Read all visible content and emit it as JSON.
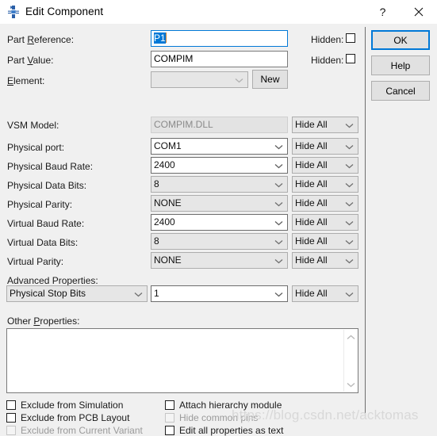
{
  "window": {
    "title": "Edit Component",
    "icon": "component-icon",
    "help_glyph": "?",
    "close_glyph": "✕"
  },
  "fields": {
    "part_reference": {
      "label_pre": "Part ",
      "label_key": "R",
      "label_post": "eference:",
      "value": "P1",
      "hidden_label": "Hidden:",
      "hidden_checked": false
    },
    "part_value": {
      "label_pre": "Part ",
      "label_key": "V",
      "label_post": "alue:",
      "value": "COMPIM",
      "hidden_label": "Hidden:",
      "hidden_checked": false
    },
    "element": {
      "label_pre": "",
      "label_key": "E",
      "label_post": "lement:",
      "value": "",
      "new_button": "New"
    },
    "vsm_model": {
      "label": "VSM Model:",
      "value": "COMPIM.DLL",
      "hide": "Hide All"
    },
    "physical_port": {
      "label": "Physical port:",
      "value": "COM1",
      "hide": "Hide All"
    },
    "physical_baud_rate": {
      "label": "Physical Baud Rate:",
      "value": "2400",
      "hide": "Hide All"
    },
    "physical_data_bits": {
      "label": "Physical Data Bits:",
      "value": "8",
      "hide": "Hide All"
    },
    "physical_parity": {
      "label": "Physical Parity:",
      "value": "NONE",
      "hide": "Hide All"
    },
    "virtual_baud_rate": {
      "label": "Virtual Baud Rate:",
      "value": "2400",
      "hide": "Hide All"
    },
    "virtual_data_bits": {
      "label": "Virtual Data Bits:",
      "value": "8",
      "hide": "Hide All"
    },
    "virtual_parity": {
      "label": "Virtual Parity:",
      "value": "NONE",
      "hide": "Hide All"
    },
    "advanced": {
      "label": "Advanced Properties:",
      "property": "Physical Stop Bits",
      "value": "1",
      "hide": "Hide All"
    },
    "other_properties": {
      "label_pre": "Other ",
      "label_key": "P",
      "label_post": "roperties:",
      "value": ""
    }
  },
  "checkboxes": {
    "left": [
      {
        "label": "Exclude from Simulation",
        "checked": false,
        "disabled": false
      },
      {
        "label": "Exclude from PCB Layout",
        "checked": false,
        "disabled": false
      },
      {
        "label": "Exclude from Current Variant",
        "checked": false,
        "disabled": true
      }
    ],
    "right": [
      {
        "label": "Attach hierarchy module",
        "checked": false,
        "disabled": false
      },
      {
        "label": "Hide common pins",
        "checked": false,
        "disabled": true
      },
      {
        "label": "Edit all properties as text",
        "checked": false,
        "disabled": false
      }
    ]
  },
  "buttons": {
    "ok": "OK",
    "help": "Help",
    "cancel": "Cancel"
  },
  "watermark": "https://blog.csdn.net/acktomas",
  "colors": {
    "accent": "#0078d7",
    "dialog_bg": "#f0f0f0",
    "disabled_bg": "#e3e3e3",
    "combo_bg": "#e6e6e6"
  }
}
